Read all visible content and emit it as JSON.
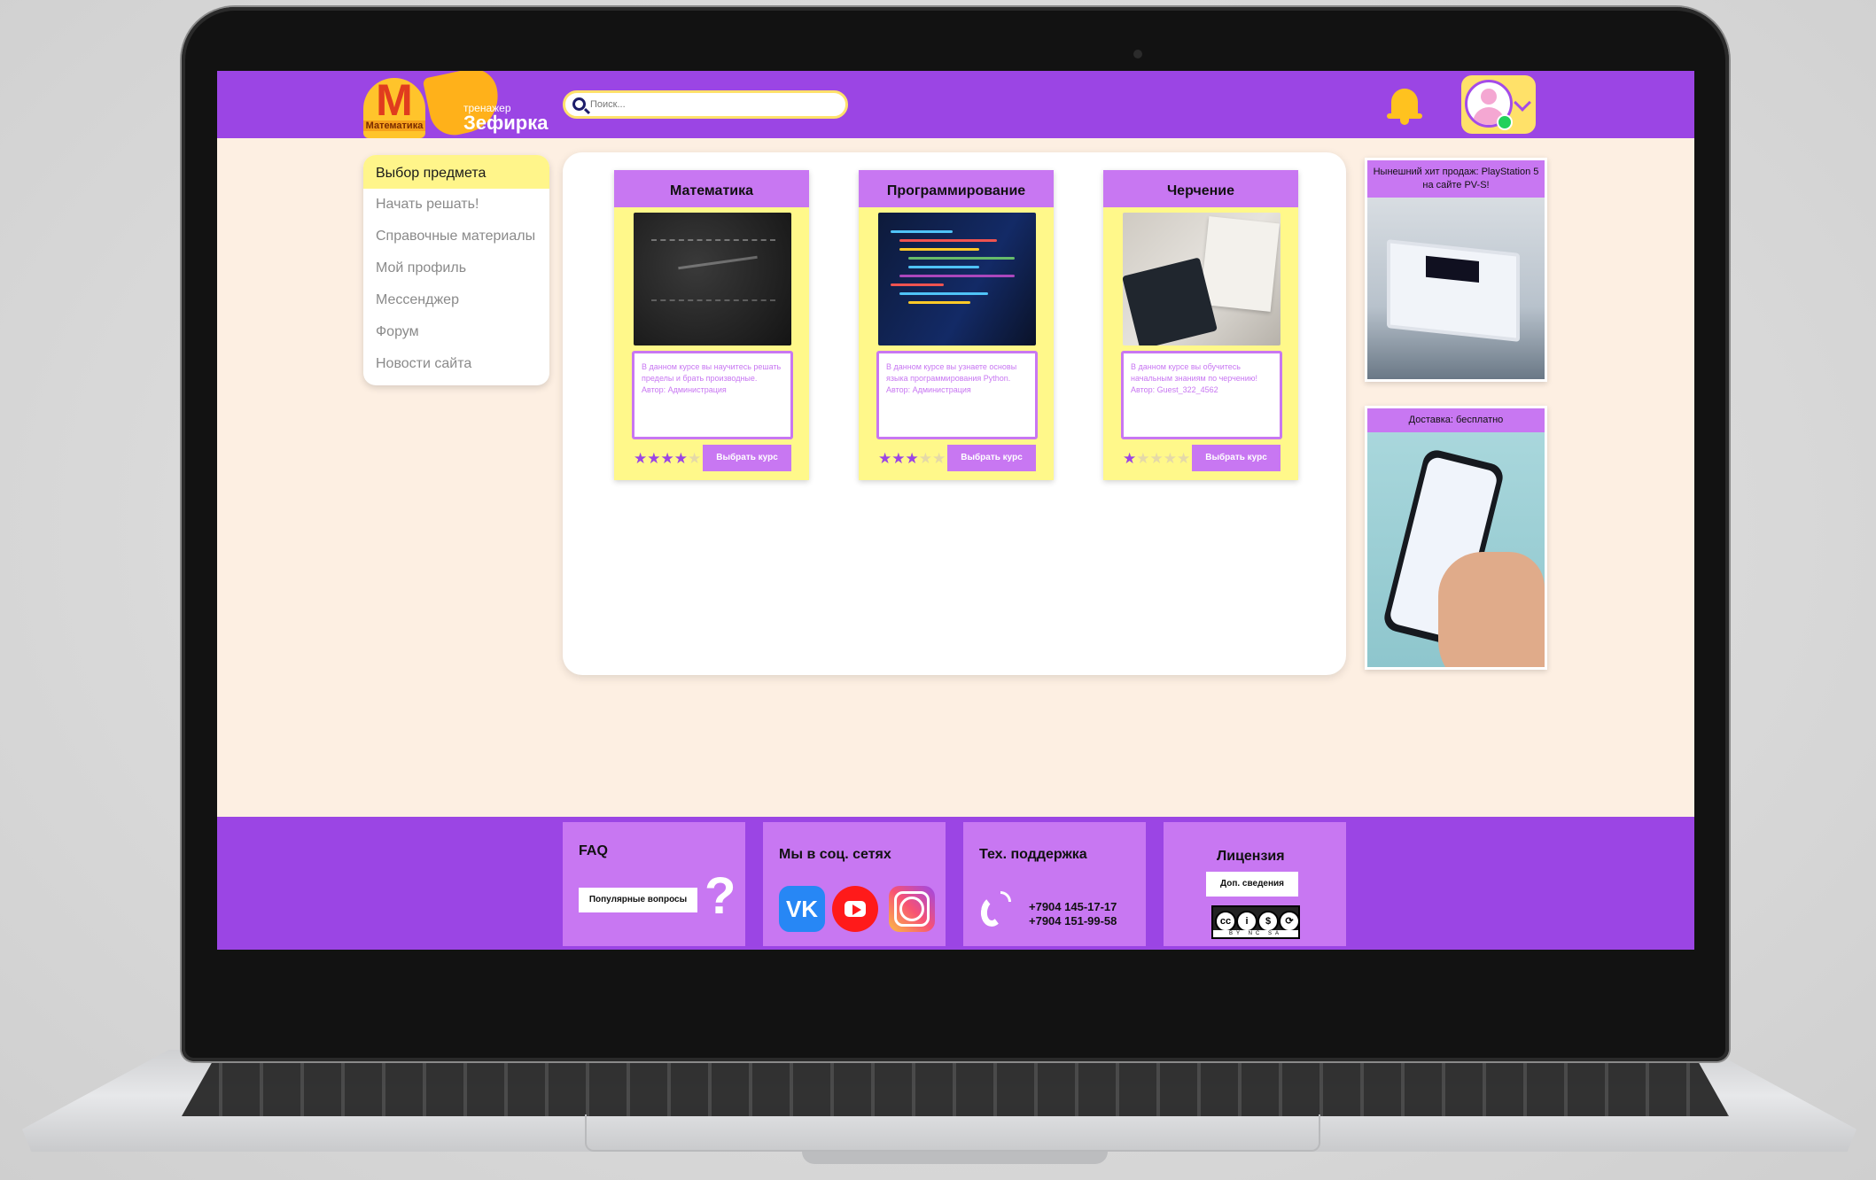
{
  "brand": {
    "logo_letter": "M",
    "logo_caption": "Математика",
    "subtitle": "тренажер",
    "name": "Зефирка"
  },
  "search": {
    "placeholder": "Поиск..."
  },
  "sidebar": {
    "items": [
      {
        "label": "Выбор предмета",
        "active": true
      },
      {
        "label": "Начать решать!"
      },
      {
        "label": "Справочные материалы"
      },
      {
        "label": "Мой профиль"
      },
      {
        "label": "Мессенджер"
      },
      {
        "label": "Форум"
      },
      {
        "label": "Новости сайта"
      }
    ]
  },
  "courses": [
    {
      "title": "Математика",
      "description": "В данном курсе вы научитесь решать пределы и брать производные.",
      "author": "Автор: Администрация",
      "rating": 4,
      "rating_text": "★★★★",
      "rating_off": "★",
      "button": "Выбрать курс"
    },
    {
      "title": "Программирование",
      "description": "В данном курсе вы узнаете основы языка программирования Python.",
      "author": "Автор: Администрация",
      "rating": 3,
      "rating_text": "★★★",
      "rating_off": "★★",
      "button": "Выбрать курс"
    },
    {
      "title": "Черчение",
      "description": "В данном курсе вы обучитесь начальным знаниям по черчению!",
      "author": "Автор: Guest_322_4562",
      "rating": 1,
      "rating_text": "★",
      "rating_off": "★★★★",
      "button": "Выбрать курс"
    }
  ],
  "ads": [
    {
      "title": "Нынешний хит продаж: PlayStation 5 на сайте PV-S!"
    },
    {
      "title": "Доставка: бесплатно"
    }
  ],
  "footer": {
    "faq": {
      "title": "FAQ",
      "button": "Популярные вопросы",
      "mark": "?"
    },
    "social": {
      "title": "Мы в соц. сетях",
      "vk": "VK"
    },
    "support": {
      "title": "Тех. поддержка",
      "phone1": "+7904 145-17-17",
      "phone2": "+7904 151-99-58"
    },
    "license": {
      "title": "Лицензия",
      "button": "Доп. сведения",
      "cc_labels": "BY NC SA"
    }
  },
  "colors": {
    "purple": "#9b45e4",
    "lilac": "#c877f2",
    "yellow": "#fff88a",
    "background": "#fdefe2"
  }
}
